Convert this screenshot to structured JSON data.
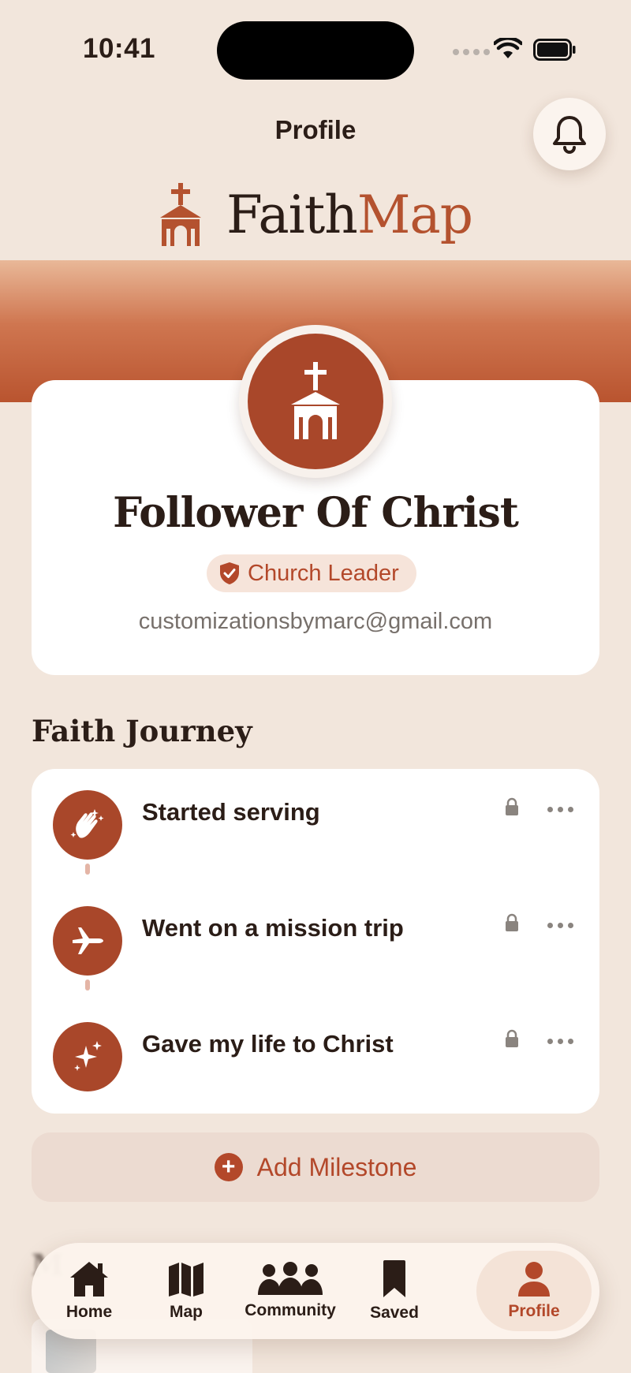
{
  "status_bar": {
    "time": "10:41"
  },
  "header": {
    "title": "Profile"
  },
  "brand": {
    "name_part1": "Faith",
    "name_part2": "Map"
  },
  "profile": {
    "name": "Follower Of Christ",
    "role": "Church Leader",
    "email": "customizationsbymarc@gmail.com"
  },
  "journey": {
    "title": "Faith Journey",
    "items": [
      {
        "label": "Started serving",
        "icon": "clapping-hands-icon"
      },
      {
        "label": "Went on a mission trip",
        "icon": "airplane-icon"
      },
      {
        "label": "Gave my life to Christ",
        "icon": "sparkles-icon"
      }
    ],
    "add_label": "Add Milestone"
  },
  "tabs": [
    {
      "label": "Home",
      "icon": "home-icon"
    },
    {
      "label": "Map",
      "icon": "map-icon"
    },
    {
      "label": "Community",
      "icon": "community-icon"
    },
    {
      "label": "Saved",
      "icon": "bookmark-icon"
    },
    {
      "label": "Profile",
      "icon": "person-icon",
      "active": true
    }
  ],
  "colors": {
    "accent": "#b3482a",
    "background": "#f2e6dc",
    "card": "#ffffff"
  }
}
